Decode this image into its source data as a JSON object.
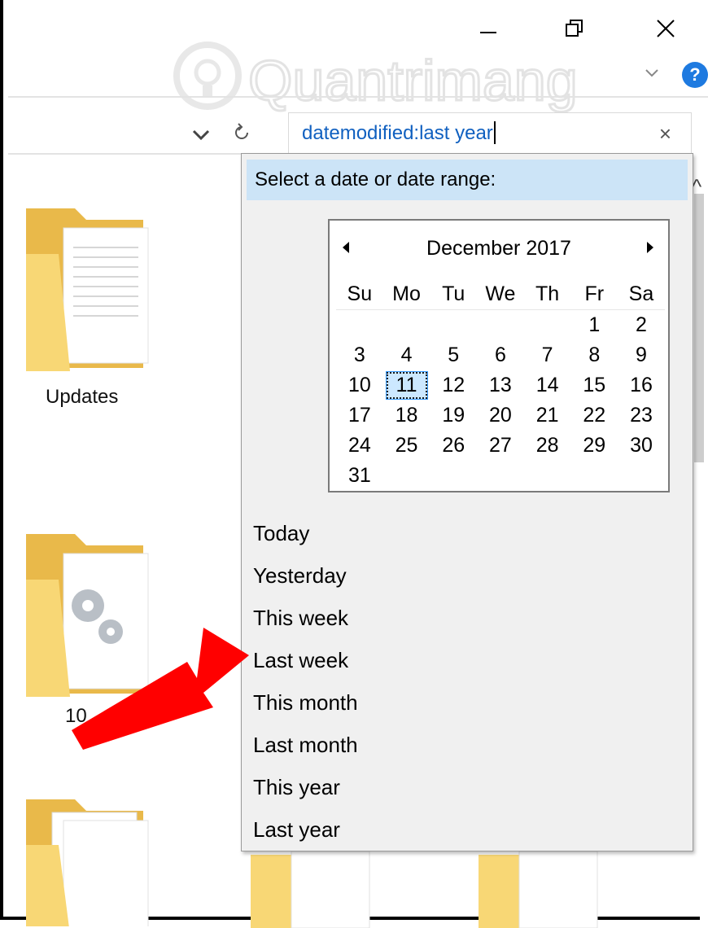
{
  "window": {
    "minimize_icon": "minimize-icon",
    "maximize_icon": "restore-icon",
    "close_icon": "close-icon",
    "help_label": "?"
  },
  "watermark": {
    "text": "Quantrimang"
  },
  "search": {
    "value": "datemodified:last year",
    "clear_label": "×"
  },
  "folders": [
    {
      "label": "Updates"
    },
    {
      "label": "10"
    }
  ],
  "date_picker": {
    "header": "Select a date or date range:",
    "month_title": "December 2017",
    "weekdays": [
      "Su",
      "Mo",
      "Tu",
      "We",
      "Th",
      "Fr",
      "Sa"
    ],
    "weeks": [
      [
        "",
        "",
        "",
        "",
        "",
        "1",
        "2"
      ],
      [
        "3",
        "4",
        "5",
        "6",
        "7",
        "8",
        "9"
      ],
      [
        "10",
        "11",
        "12",
        "13",
        "14",
        "15",
        "16"
      ],
      [
        "17",
        "18",
        "19",
        "20",
        "21",
        "22",
        "23"
      ],
      [
        "24",
        "25",
        "26",
        "27",
        "28",
        "29",
        "30"
      ],
      [
        "31",
        "",
        "",
        "",
        "",
        "",
        ""
      ]
    ],
    "selected_day": "11"
  },
  "options": [
    "Today",
    "Yesterday",
    "This week",
    "Last week",
    "This month",
    "Last month",
    "This year",
    "Last year"
  ],
  "colors": {
    "header_bg": "#cce4f7",
    "accent": "#1e7ae0",
    "arrow": "#ff0000",
    "folder": "#f8d775"
  }
}
